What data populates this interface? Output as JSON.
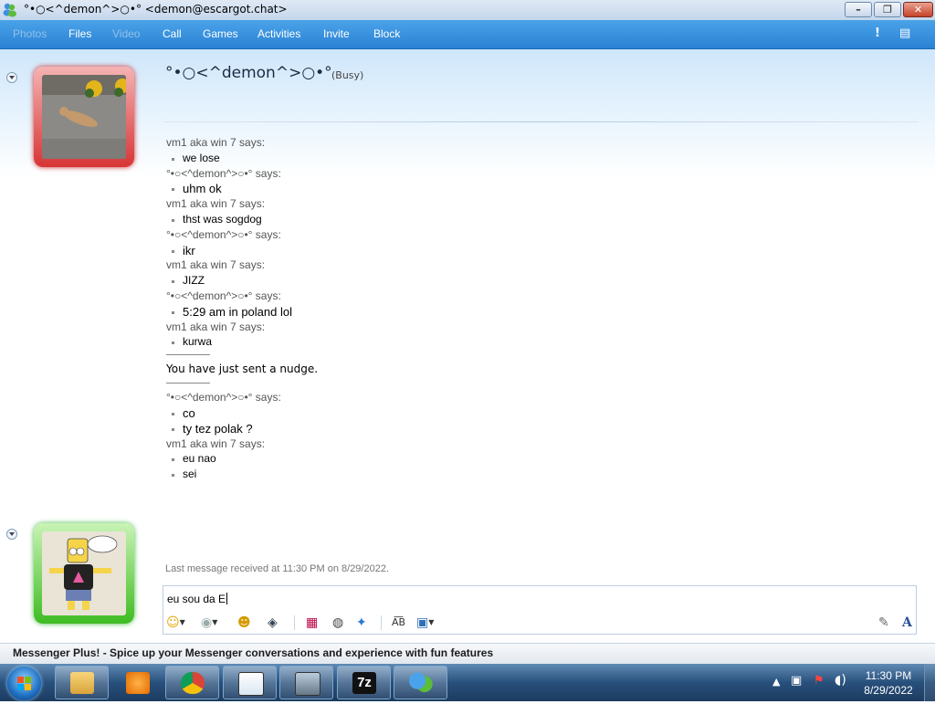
{
  "window": {
    "title": "°•○<^demon^>○•° <demon@escargot.chat>",
    "icon": "messenger-buddy-icon"
  },
  "menu": {
    "items": [
      {
        "label": "Photos",
        "enabled": false
      },
      {
        "label": "Files",
        "enabled": true
      },
      {
        "label": "Video",
        "enabled": false
      },
      {
        "label": "Call",
        "enabled": true
      },
      {
        "label": "Games",
        "enabled": true
      },
      {
        "label": "Activities",
        "enabled": true
      },
      {
        "label": "Invite",
        "enabled": true
      },
      {
        "label": "Block",
        "enabled": true
      }
    ],
    "alert_glyph": "!",
    "options_glyph": "▤"
  },
  "contact": {
    "name": "°•○<^demon^>○•°",
    "status": "(Busy)",
    "status_color": "#d73535"
  },
  "conversation": [
    {
      "type": "says",
      "text": "vm1 aka win 7 says:"
    },
    {
      "type": "msg",
      "text": "we lose"
    },
    {
      "type": "says",
      "text": "°•○<^demon^>○•° says:"
    },
    {
      "type": "msg",
      "text": "uhm ok",
      "big": true
    },
    {
      "type": "says",
      "text": "vm1 aka win 7 says:"
    },
    {
      "type": "msg",
      "text": "thst was sogdog"
    },
    {
      "type": "says",
      "text": "°•○<^demon^>○•° says:"
    },
    {
      "type": "msg",
      "text": "ikr",
      "big": true
    },
    {
      "type": "says",
      "text": "vm1 aka win 7 says:"
    },
    {
      "type": "msg",
      "text": "JIZZ"
    },
    {
      "type": "says",
      "text": "°•○<^demon^>○•° says:"
    },
    {
      "type": "msg",
      "text": "5:29 am in poland lol",
      "big": true
    },
    {
      "type": "says",
      "text": "vm1 aka win 7 says:"
    },
    {
      "type": "msg",
      "text": "kurwa"
    },
    {
      "type": "sep"
    },
    {
      "type": "note",
      "text": "You have just sent a nudge."
    },
    {
      "type": "sep"
    },
    {
      "type": "says",
      "text": "°•○<^demon^>○•° says:"
    },
    {
      "type": "msg",
      "text": "co",
      "big": true
    },
    {
      "type": "msg",
      "text": "ty tez polak ?",
      "big": true
    },
    {
      "type": "says",
      "text": "vm1 aka win 7 says:"
    },
    {
      "type": "msg",
      "text": "eu nao"
    },
    {
      "type": "msg",
      "text": "sei"
    }
  ],
  "last_message": "Last message received at 11:30 PM on 8/29/2022.",
  "input": {
    "value": "eu sou da E"
  },
  "toolbar": {
    "emoticon": "☺",
    "wink": "◉",
    "nudge": "☻",
    "voice_clip": "◈",
    "background": "▦",
    "sound": "◍",
    "games": "✦",
    "spellcheck": "A͞B",
    "send_files": "▣",
    "handwriting": "✎",
    "font": "A"
  },
  "plus_bar": {
    "text": "Messenger Plus! - Spice up your Messenger conversations and experience with fun features"
  },
  "taskbar": {
    "pinned": [
      "windows-explorer",
      "windows-media-player",
      "google-chrome",
      "notepad",
      "task-manager",
      "7-zip",
      "windows-live-messenger"
    ],
    "sevenzip_label": "7z",
    "clock_time": "11:30 PM",
    "clock_date": "8/29/2022"
  }
}
